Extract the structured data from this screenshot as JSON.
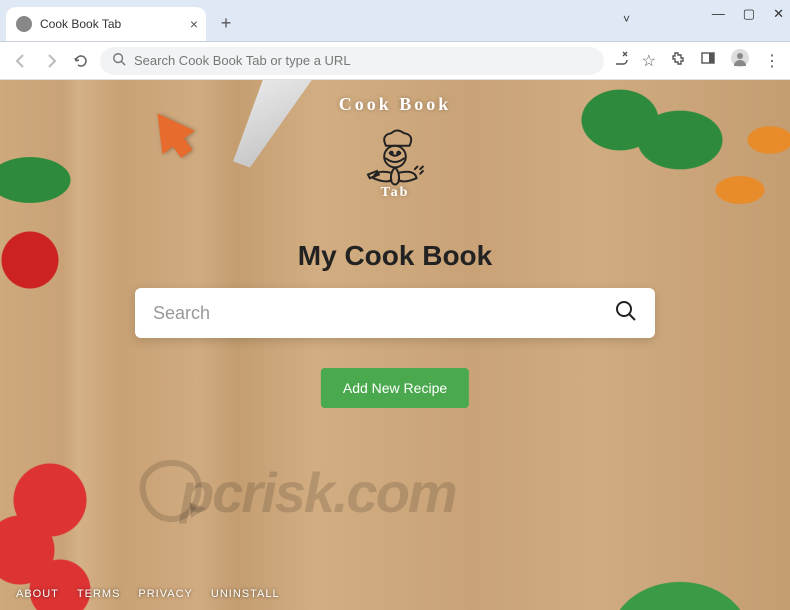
{
  "browser": {
    "tab_title": "Cook Book Tab",
    "omnibox_placeholder": "Search Cook Book Tab or type a URL"
  },
  "logo": {
    "arc_top": "Cook Book",
    "arc_bottom": "Tab"
  },
  "page": {
    "heading": "My Cook Book",
    "search_placeholder": "Search",
    "add_button": "Add New Recipe"
  },
  "footer": {
    "about": "ABOUT",
    "terms": "TERMS",
    "privacy": "PRIVACY",
    "uninstall": "UNINSTALL"
  },
  "watermark": "pcrisk.com"
}
